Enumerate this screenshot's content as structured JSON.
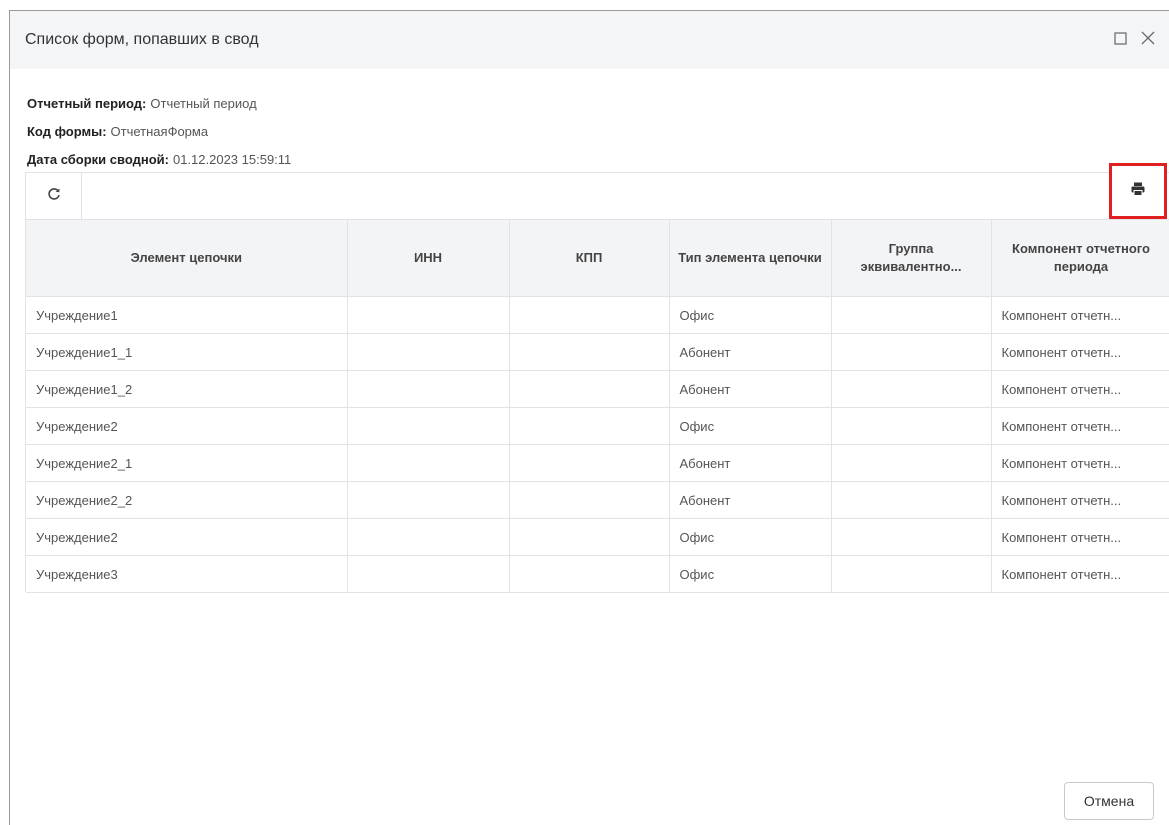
{
  "dialog": {
    "title": "Список форм, попавших в свод",
    "maximize_icon": "maximize-icon",
    "close_icon": "close-icon"
  },
  "info": {
    "period_label": "Отчетный период:",
    "period_value": "Отчетный период",
    "form_code_label": "Код формы:",
    "form_code_value": "ОтчетнаяФорма",
    "build_date_label": "Дата сборки сводной:",
    "build_date_value": "01.12.2023 15:59:11"
  },
  "toolbar": {
    "refresh_icon": "refresh-icon",
    "print_icon": "print-icon",
    "highlight_color": "#e02020"
  },
  "table": {
    "columns": [
      "Элемент цепочки",
      "ИНН",
      "КПП",
      "Тип элемента цепочки",
      "Группа эквивалентно...",
      "Компонент отчетного периода"
    ],
    "rows": [
      [
        "Учреждение1",
        "",
        "",
        "Офис",
        "",
        "Компонент отчетн..."
      ],
      [
        "Учреждение1_1",
        "",
        "",
        "Абонент",
        "",
        "Компонент отчетн..."
      ],
      [
        "Учреждение1_2",
        "",
        "",
        "Абонент",
        "",
        "Компонент отчетн..."
      ],
      [
        "Учреждение2",
        "",
        "",
        "Офис",
        "",
        "Компонент отчетн..."
      ],
      [
        "Учреждение2_1",
        "",
        "",
        "Абонент",
        "",
        "Компонент отчетн..."
      ],
      [
        "Учреждение2_2",
        "",
        "",
        "Абонент",
        "",
        "Компонент отчетн..."
      ],
      [
        "Учреждение2",
        "",
        "",
        "Офис",
        "",
        "Компонент отчетн..."
      ],
      [
        "Учреждение3",
        "",
        "",
        "Офис",
        "",
        "Компонент отчетн..."
      ]
    ]
  },
  "footer": {
    "cancel_label": "Отмена"
  }
}
